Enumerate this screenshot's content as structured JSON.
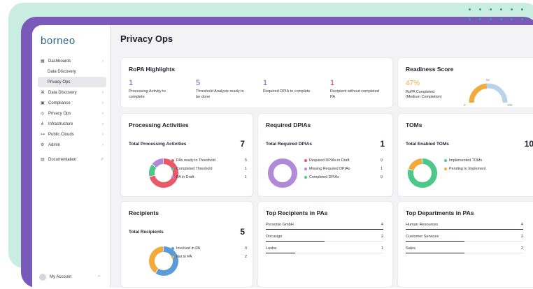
{
  "app": {
    "logo": "borneo",
    "page_title": "Privacy Ops"
  },
  "sidebar": {
    "items": [
      {
        "label": "Dashboards",
        "icon": "dashboard-icon",
        "chevron": "›"
      },
      {
        "label": "Data Discovery",
        "sub": true
      },
      {
        "label": "Privacy Ops",
        "sub": true,
        "active": true
      },
      {
        "label": "Data Discovery",
        "icon": "discovery-icon",
        "chevron": "›"
      },
      {
        "label": "Compliance",
        "icon": "compliance-icon",
        "chevron": "›"
      },
      {
        "label": "Privacy Ops",
        "icon": "privacy-icon",
        "chevron": "›"
      },
      {
        "label": "Infrastructure",
        "icon": "infrastructure-icon",
        "chevron": "›"
      },
      {
        "label": "Public Clouds",
        "icon": "cloud-icon",
        "chevron": "›"
      },
      {
        "label": "Admin",
        "icon": "admin-icon",
        "chevron": "›"
      },
      {
        "label": "Documentation",
        "icon": "document-icon",
        "chevron": "↗"
      }
    ],
    "account_label": "My Account"
  },
  "ropa": {
    "title": "RoPA Highlights",
    "items": [
      {
        "value": "1",
        "label": "Processing Activity to complete",
        "color": "#7a4cc4"
      },
      {
        "value": "5",
        "label": "Threshold Analysis ready to be done",
        "color": "#7a4cc4"
      },
      {
        "value": "1",
        "label": "Required DPIA to complete",
        "color": "#7a4cc4"
      },
      {
        "value": "1",
        "label": "Recipient without completed PA",
        "color": "#d6304f"
      }
    ]
  },
  "readiness": {
    "title": "Readiness Score",
    "value": "47%",
    "label1": "RoPA Completed",
    "label2": "(Medium Completion)",
    "gauge_fraction": 0.47,
    "tick_min": "0",
    "tick_mid": "50",
    "tick_max": "100",
    "colors": {
      "fill": "#f4a93b",
      "rest": "#b9d3ea"
    }
  },
  "processing": {
    "title": "Processing Activities",
    "subtitle": "Total Processing Activities",
    "total": "7",
    "legend": [
      {
        "label": "PAs ready to Threshold",
        "value": "5",
        "color": "#e85a6a"
      },
      {
        "label": "Completed Threshold",
        "value": "1",
        "color": "#4cc98a"
      },
      {
        "label": "PA in Draft",
        "value": "1",
        "color": "#b08ad8"
      }
    ]
  },
  "dpias": {
    "title": "Required DPIAs",
    "subtitle": "Total Required DPIAs",
    "total": "1",
    "legend": [
      {
        "label": "Required DPIAs in Draft",
        "value": "0",
        "color": "#e85a6a"
      },
      {
        "label": "Missing Required DPIAs",
        "value": "1",
        "color": "#b08ad8"
      },
      {
        "label": "Completed DPIAs",
        "value": "0",
        "color": "#4cc98a"
      }
    ]
  },
  "toms": {
    "title": "TOMs",
    "subtitle": "Total Enabled TOMs",
    "total": "10",
    "legend": [
      {
        "label": "Implemented TOMs",
        "value": "8",
        "color": "#4cc98a"
      },
      {
        "label": "Pending to Implement",
        "value": "2",
        "color": "#f4a93b"
      }
    ]
  },
  "recipients": {
    "title": "Recipients",
    "subtitle": "Total Recipients",
    "total": "5",
    "legend": [
      {
        "label": "Involved in PA",
        "value": "3",
        "color": "#5b9bd8"
      },
      {
        "label": "Not in PA",
        "value": "2",
        "color": "#f4a93b"
      }
    ]
  },
  "top_recipients": {
    "title": "Top Recipients in PAs",
    "rows": [
      {
        "label": "Personio GmbH",
        "value": "4",
        "fraction": 1.0
      },
      {
        "label": "Docusign",
        "value": "2",
        "fraction": 0.5
      },
      {
        "label": "Lusha",
        "value": "1",
        "fraction": 0.25
      }
    ]
  },
  "top_departments": {
    "title": "Top Departments in PAs",
    "rows": [
      {
        "label": "Human Resources",
        "value": "4",
        "fraction": 1.0
      },
      {
        "label": "Customer Services",
        "value": "2",
        "fraction": 0.5
      },
      {
        "label": "Sales",
        "value": "2",
        "fraction": 0.5
      }
    ]
  }
}
